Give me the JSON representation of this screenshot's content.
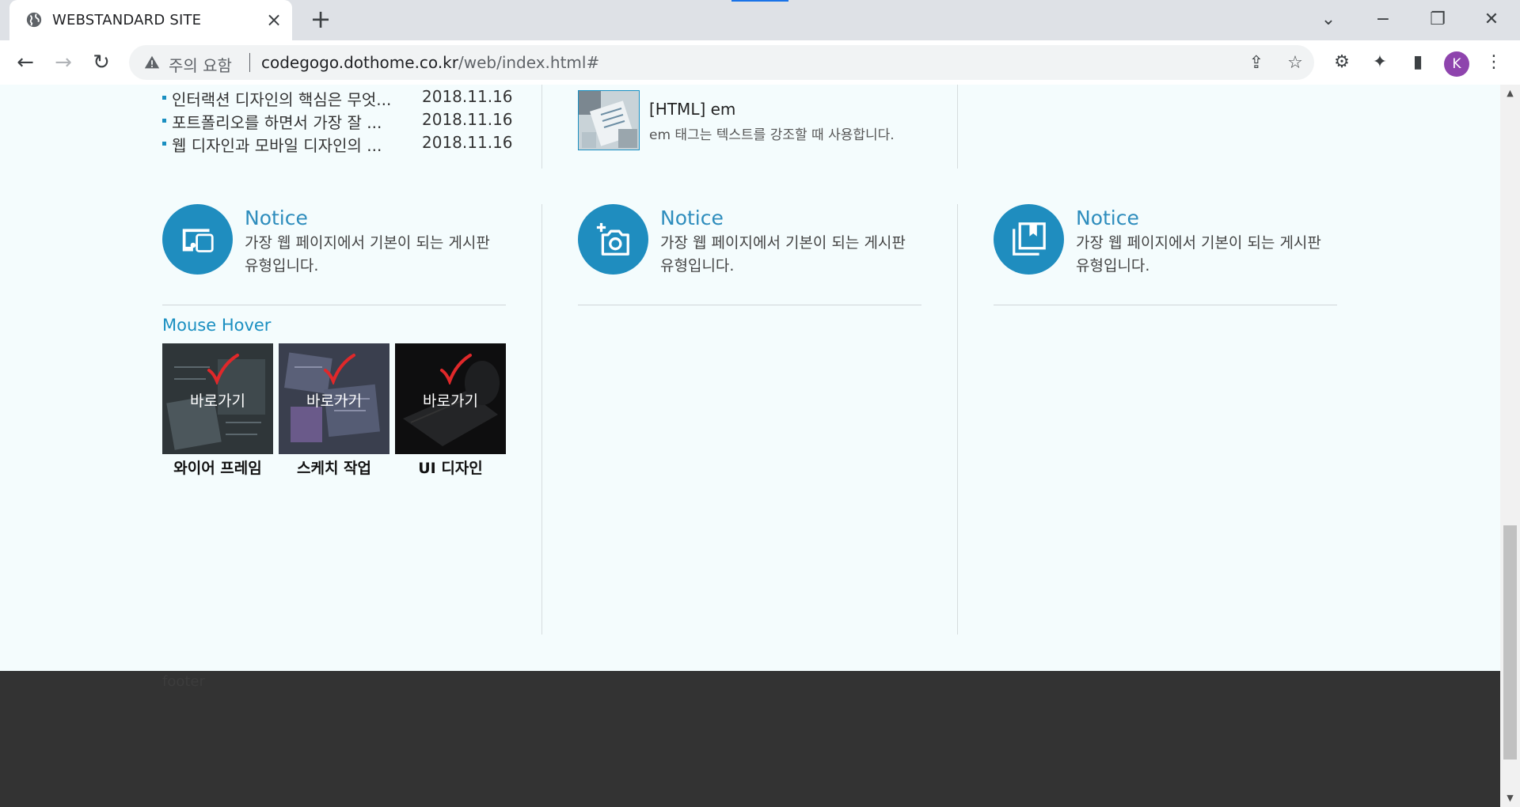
{
  "browser": {
    "tab_title": "WEBSTANDARD SITE",
    "security_label": "주의 요함",
    "url_host": "codegogo.dothome.co.kr",
    "url_path": "/web/index.html#",
    "profile_initial": "K"
  },
  "notices": [
    {
      "title": "인터랙션 디자인의 핵심은 무엇...",
      "date": "2018.11.16"
    },
    {
      "title": "포트폴리오를 하면서 가장 잘 ...",
      "date": "2018.11.16"
    },
    {
      "title": "웹 디자인과 모바일 디자인의 ...",
      "date": "2018.11.16"
    }
  ],
  "news": {
    "title": "[HTML] em",
    "desc": "em 태그는 텍스트를 강조할 때 사용합니다."
  },
  "icon_blocks": [
    {
      "icon": "devices-icon",
      "title": "Notice",
      "desc": "가장 웹 페이지에서 기본이 되는 게시판 유형입니다."
    },
    {
      "icon": "camera-add-icon",
      "title": "Notice",
      "desc": "가장 웹 페이지에서 기본이 되는 게시판 유형입니다."
    },
    {
      "icon": "library-bookmark-icon",
      "title": "Notice",
      "desc": "가장 웹 페이지에서 기본이 되는 게시판 유형입니다."
    }
  ],
  "mouse_hover": {
    "title": "Mouse Hover",
    "items": [
      {
        "overlay": "바로가기",
        "label": "와이어 프레임"
      },
      {
        "overlay": "바로가기",
        "label": "스케치 작업"
      },
      {
        "overlay": "바로가기",
        "label": "UI 디자인"
      }
    ]
  },
  "footer": {
    "text": "footer"
  },
  "colors": {
    "accent": "#1f8dbf",
    "page_bg": "#f4fcfd",
    "footer_bg": "#333333",
    "check": "#e0282a"
  }
}
